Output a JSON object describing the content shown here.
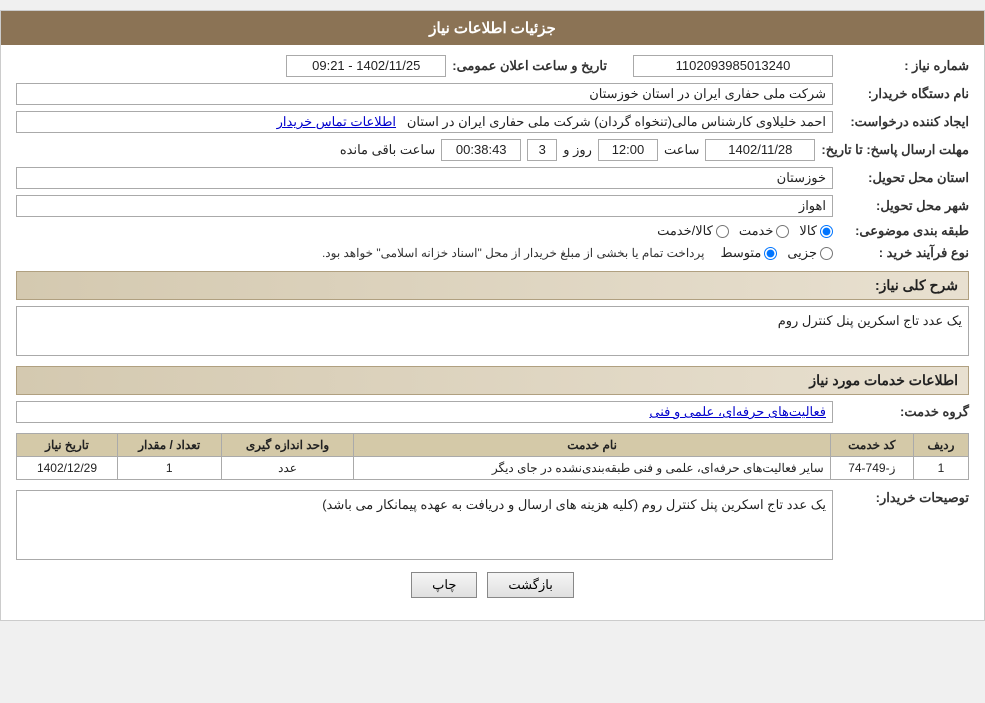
{
  "header": {
    "title": "جزئیات اطلاعات نیاز"
  },
  "fields": {
    "need_number_label": "شماره نیاز :",
    "need_number_value": "1102093985013240",
    "announce_datetime_label": "تاریخ و ساعت اعلان عمومی:",
    "announce_datetime_value": "1402/11/25 - 09:21",
    "buyer_name_label": "نام دستگاه خریدار:",
    "buyer_name_value": "شرکت ملی حفاری ایران در استان خوزستان",
    "creator_label": "ایجاد کننده درخواست:",
    "creator_value": "احمد خلیلاوی کارشناس مالی(تنخواه گردان) شرکت ملی حفاری ایران در استان",
    "creator_link": "اطلاعات تماس خریدار",
    "response_deadline_label": "مهلت ارسال پاسخ: تا تاریخ:",
    "response_date": "1402/11/28",
    "response_time_label": "ساعت",
    "response_time": "12:00",
    "response_days_label": "روز و",
    "response_days": "3",
    "remaining_time": "00:38:43",
    "remaining_label": "ساعت باقی مانده",
    "delivery_province_label": "استان محل تحویل:",
    "delivery_province_value": "خوزستان",
    "delivery_city_label": "شهر محل تحویل:",
    "delivery_city_value": "اهواز",
    "category_label": "طبقه بندی موضوعی:",
    "category_options": [
      "کالا",
      "خدمت",
      "کالا/خدمت"
    ],
    "category_selected": "کالا",
    "purchase_type_label": "نوع فرآیند خرید :",
    "purchase_types": [
      "جزیی",
      "متوسط"
    ],
    "purchase_note": "پرداخت تمام یا بخشی از مبلغ خریدار از محل \"اسناد خزانه اسلامی\" خواهد بود.",
    "need_description_label": "شرح کلی نیاز:",
    "need_description_value": "یک عدد تاج اسکرین پنل کنترل روم",
    "service_info_label": "اطلاعات خدمات مورد نیاز",
    "service_group_label": "گروه خدمت:",
    "service_group_value": "فعالیت‌های حرفه‌ای، علمی و فنی"
  },
  "table": {
    "headers": [
      "ردیف",
      "کد خدمت",
      "نام خدمت",
      "واحد اندازه گیری",
      "تعداد / مقدار",
      "تاریخ نیاز"
    ],
    "rows": [
      {
        "row_num": "1",
        "service_code": "ز-749-74",
        "service_name": "سایر فعالیت‌های حرفه‌ای، علمی و فنی طبقه‌بندی‌نشده در جای دیگر",
        "unit": "عدد",
        "quantity": "1",
        "need_date": "1402/12/29"
      }
    ]
  },
  "buyer_desc_label": "توصیحات خریدار:",
  "buyer_desc_value": "یک عدد تاج اسکرین پنل کنترل روم (کلیه هزینه های ارسال و دریافت به عهده پیمانکار می باشد)",
  "buttons": {
    "print": "چاپ",
    "back": "بازگشت"
  }
}
